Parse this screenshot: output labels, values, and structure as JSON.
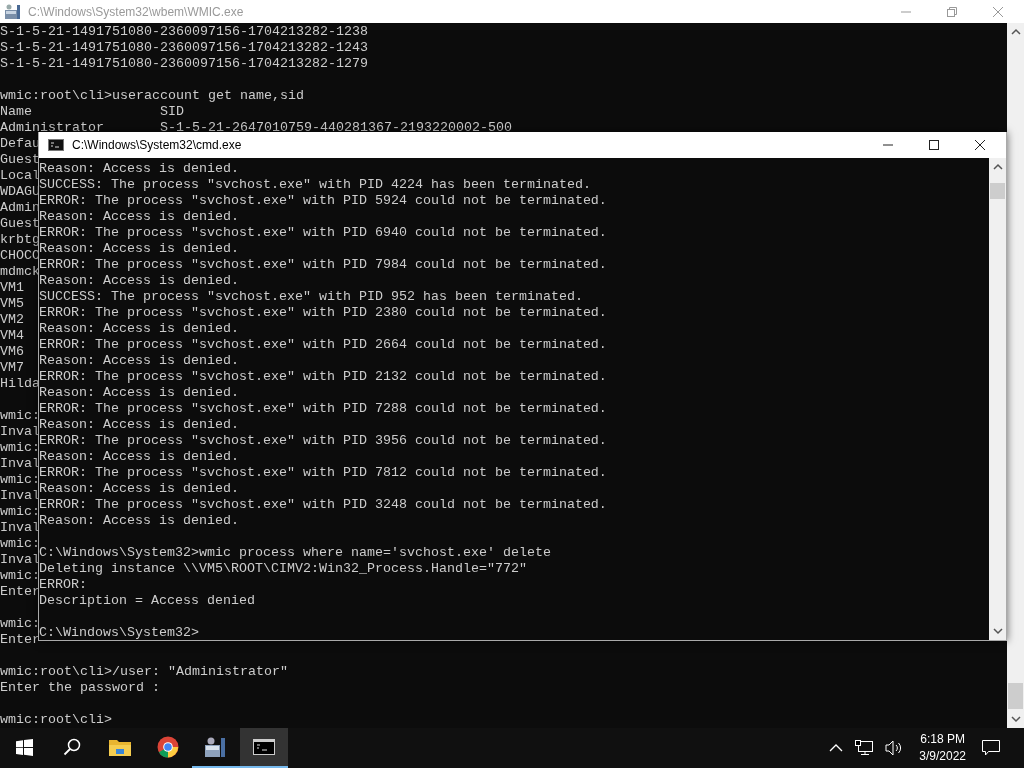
{
  "background_window": {
    "title": "C:\\Windows\\System32\\wbem\\WMIC.exe",
    "active": false,
    "blocks": [
      [
        "S-1-5-21-1491751080-2360097156-1704213282-1238",
        "S-1-5-21-1491751080-2360097156-1704213282-1243",
        "S-1-5-21-1491751080-2360097156-1704213282-1279"
      ],
      [
        "wmic:root\\cli>useraccount get name,sid",
        "Name                SID",
        "Administrator       S-1-5-21-2647010759-440281367-2193220002-500",
        "Defau",
        "Guest",
        "Local",
        "WDAGU",
        "Admin",
        "Guest",
        "krbtg",
        "CHOCO",
        "mdmck",
        "VM1",
        "VM5",
        "VM2",
        "VM4",
        "VM6",
        "VM7",
        "Hilda"
      ],
      [
        "wmic:",
        "Inval",
        "wmic:",
        "Inval",
        "wmic:",
        "Inval",
        "wmic:",
        "Inval",
        "wmic:",
        "Inval",
        "wmic:",
        "Enter"
      ],
      [
        "wmic:",
        "Enter"
      ],
      [
        "wmic:root\\cli>/user: \"Administrator\"",
        "Enter the password :"
      ],
      [
        "wmic:root\\cli>"
      ]
    ]
  },
  "front_window": {
    "title": "C:\\Windows\\System32\\cmd.exe",
    "active": true,
    "blocks": [
      [
        "Reason: Access is denied.",
        "SUCCESS: The process \"svchost.exe\" with PID 4224 has been terminated.",
        "ERROR: The process \"svchost.exe\" with PID 5924 could not be terminated.",
        "Reason: Access is denied.",
        "ERROR: The process \"svchost.exe\" with PID 6940 could not be terminated.",
        "Reason: Access is denied.",
        "ERROR: The process \"svchost.exe\" with PID 7984 could not be terminated.",
        "Reason: Access is denied.",
        "SUCCESS: The process \"svchost.exe\" with PID 952 has been terminated.",
        "ERROR: The process \"svchost.exe\" with PID 2380 could not be terminated.",
        "Reason: Access is denied.",
        "ERROR: The process \"svchost.exe\" with PID 2664 could not be terminated.",
        "Reason: Access is denied.",
        "ERROR: The process \"svchost.exe\" with PID 2132 could not be terminated.",
        "Reason: Access is denied.",
        "ERROR: The process \"svchost.exe\" with PID 7288 could not be terminated.",
        "Reason: Access is denied.",
        "ERROR: The process \"svchost.exe\" with PID 3956 could not be terminated.",
        "Reason: Access is denied.",
        "ERROR: The process \"svchost.exe\" with PID 7812 could not be terminated.",
        "Reason: Access is denied.",
        "ERROR: The process \"svchost.exe\" with PID 3248 could not be terminated.",
        "Reason: Access is denied."
      ],
      [
        "C:\\Windows\\System32>wmic process where name='svchost.exe' delete",
        "Deleting instance \\\\VM5\\ROOT\\CIMV2:Win32_Process.Handle=\"772\"",
        "ERROR:",
        "Description = Access denied"
      ],
      [
        "C:\\Windows\\System32>"
      ]
    ]
  },
  "taskbar": {
    "apps": [
      {
        "kind": "start",
        "running": false,
        "active": false
      },
      {
        "kind": "search",
        "running": false,
        "active": false
      },
      {
        "kind": "folder",
        "running": false,
        "active": false
      },
      {
        "kind": "browser",
        "running": false,
        "active": false
      },
      {
        "kind": "server",
        "running": true,
        "active": false
      },
      {
        "kind": "console",
        "running": true,
        "active": true
      }
    ],
    "clock": {
      "time": "6:18 PM",
      "date": "3/9/2022"
    }
  }
}
